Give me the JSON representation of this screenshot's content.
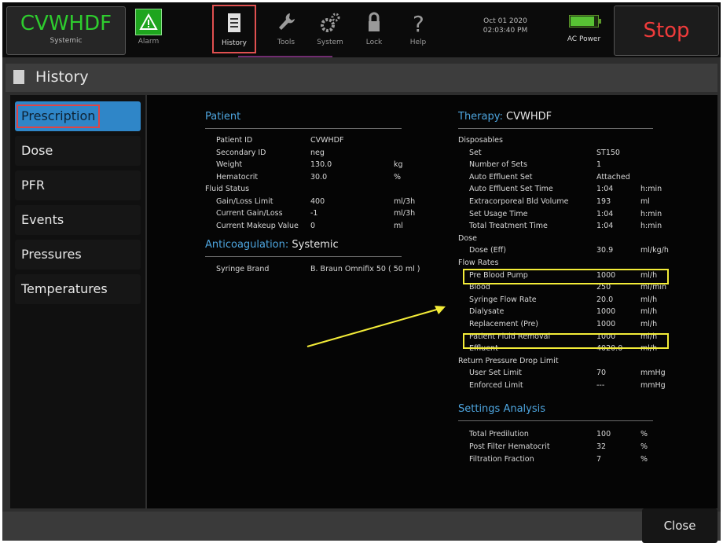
{
  "topbar": {
    "mode_title": "CVWHDF",
    "mode_subtitle": "Systemic",
    "alarm_label": "Alarm",
    "history_label": "History",
    "tools_label": "Tools",
    "system_label": "System",
    "lock_label": "Lock",
    "help_label": "Help",
    "date": "Oct 01 2020",
    "time": "02:03:40 PM",
    "power_label": "AC Power",
    "stop_label": "Stop"
  },
  "screen_title": "History",
  "sidebar": {
    "items": [
      {
        "label": "Prescription",
        "active": true
      },
      {
        "label": "Dose"
      },
      {
        "label": "PFR"
      },
      {
        "label": "Events"
      },
      {
        "label": "Pressures"
      },
      {
        "label": "Temperatures"
      }
    ]
  },
  "patient": {
    "title": "Patient",
    "rows": [
      {
        "label": "Patient ID",
        "value": "CVWHDF",
        "unit": ""
      },
      {
        "label": "Secondary ID",
        "value": "neg",
        "unit": ""
      },
      {
        "label": "Weight",
        "value": "130.0",
        "unit": "kg"
      },
      {
        "label": "Hematocrit",
        "value": "30.0",
        "unit": "%"
      },
      {
        "label": "Fluid Status",
        "value": "",
        "unit": ""
      },
      {
        "label": "Gain/Loss Limit",
        "value": "400",
        "unit": "ml/3h"
      },
      {
        "label": "Current Gain/Loss",
        "value": "-1",
        "unit": "ml/3h"
      },
      {
        "label": "Current Makeup Value",
        "value": "0",
        "unit": "ml"
      }
    ]
  },
  "anticoagulation": {
    "title": "Anticoagulation:",
    "mode": "Systemic",
    "syringe_label": "Syringe Brand",
    "syringe_value": "B. Braun Omnifix 50 ( 50 ml )"
  },
  "therapy": {
    "title": "Therapy:",
    "mode": "CVWHDF",
    "rows": [
      {
        "label": "Disposables",
        "value": "",
        "unit": ""
      },
      {
        "label": "Set",
        "value": "ST150",
        "unit": ""
      },
      {
        "label": "Number of Sets",
        "value": "1",
        "unit": ""
      },
      {
        "label": "Auto Effluent Set",
        "value": "Attached",
        "unit": ""
      },
      {
        "label": "Auto Effluent Set Time",
        "value": "1:04",
        "unit": "h:min"
      },
      {
        "label": "Extracorporeal Bld Volume",
        "value": "193",
        "unit": "ml"
      },
      {
        "label": "Set Usage Time",
        "value": "1:04",
        "unit": "h:min"
      },
      {
        "label": "Total Treatment Time",
        "value": "1:04",
        "unit": "h:min"
      },
      {
        "label": "Dose",
        "value": "",
        "unit": ""
      },
      {
        "label": "Dose (Eff)",
        "value": "30.9",
        "unit": "ml/kg/h"
      },
      {
        "label": "Flow Rates",
        "value": "",
        "unit": ""
      },
      {
        "label": "Pre Blood Pump",
        "value": "1000",
        "unit": "ml/h"
      },
      {
        "label": "Blood",
        "value": "250",
        "unit": "ml/min"
      },
      {
        "label": "Syringe Flow Rate",
        "value": "20.0",
        "unit": "ml/h"
      },
      {
        "label": "Dialysate",
        "value": "1000",
        "unit": "ml/h"
      },
      {
        "label": "Replacement (Pre)",
        "value": "1000",
        "unit": "ml/h"
      },
      {
        "label": "Patient Fluid Removal",
        "value": "1000",
        "unit": "ml/h"
      },
      {
        "label": "Effluent",
        "value": "4020.0",
        "unit": "ml/h"
      },
      {
        "label": "Return Pressure Drop Limit",
        "value": "",
        "unit": ""
      },
      {
        "label": "User Set Limit",
        "value": "70",
        "unit": "mmHg"
      },
      {
        "label": "Enforced Limit",
        "value": "---",
        "unit": "mmHg"
      }
    ]
  },
  "settings_analysis": {
    "title": "Settings Analysis",
    "rows": [
      {
        "label": "Total Predilution",
        "value": "100",
        "unit": "%"
      },
      {
        "label": "Post Filter Hematocrit",
        "value": "32",
        "unit": "%"
      },
      {
        "label": "Filtration Fraction",
        "value": "7",
        "unit": "%"
      }
    ]
  },
  "close_label": "Close",
  "colors": {
    "accent": "#4ea6e0",
    "mode_green": "#2ecc2e",
    "stop_red": "#ef3b3b",
    "highlight_yellow": "#f3ec38",
    "active_tab": "#2f86c8"
  }
}
